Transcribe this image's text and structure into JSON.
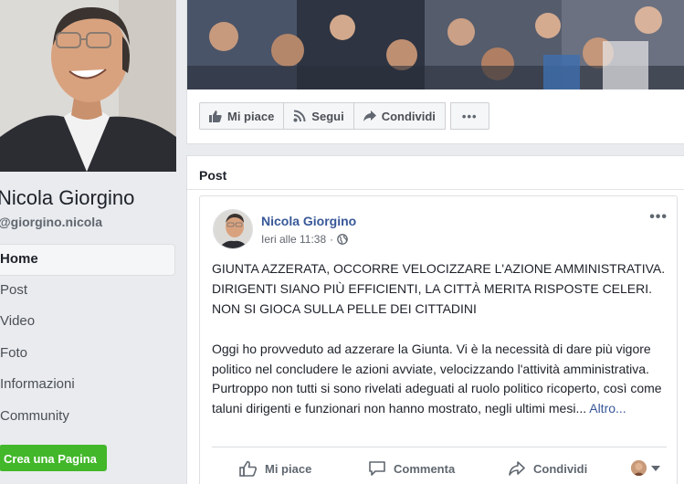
{
  "page": {
    "name": "Nicola Giorgino",
    "username": "@giorgino.nicola"
  },
  "nav": {
    "items": [
      {
        "label": "Home"
      },
      {
        "label": "Post"
      },
      {
        "label": "Video"
      },
      {
        "label": "Foto"
      },
      {
        "label": "Informazioni"
      },
      {
        "label": "Community"
      }
    ],
    "create_page": "Crea una Pagina"
  },
  "actions": {
    "like": "Mi piace",
    "follow": "Segui",
    "share": "Condividi",
    "more": "•••"
  },
  "posts": {
    "title": "Post"
  },
  "post": {
    "author": "Nicola Giorgino",
    "time": "Ieri alle 11:38",
    "separator": "·",
    "privacy_icon": "globe-icon",
    "more": "•••",
    "headline": "GIUNTA AZZERATA, OCCORRE VELOCIZZARE L'AZIONE AMMINISTRATIVA. DIRIGENTI SIANO PIÙ EFFICIENTI, LA CITTÀ MERITA RISPOSTE CELERI. NON SI GIOCA SULLA PELLE DEI CITTADINI",
    "body": "Oggi ho provveduto ad azzerare la Giunta. Vi è la necessità di dare più vigore politico nel concludere le azioni avviate, velocizzando l'attività amministrativa. Purtroppo non tutti si sono rivelati adeguati al ruolo politico ricoperto, così come taluni dirigenti e funzionari non hanno mostrato, negli ultimi mesi...",
    "more_link": "Altro...",
    "like": "Mi piace",
    "comment": "Commenta",
    "share": "Condividi"
  },
  "colors": {
    "link": "#385898",
    "create_button": "#42b72a",
    "background": "#e9ebee"
  }
}
